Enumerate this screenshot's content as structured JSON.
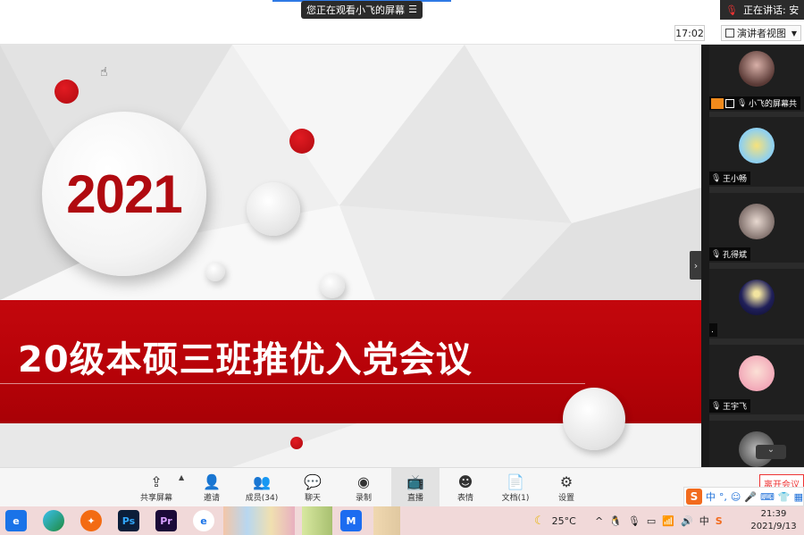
{
  "top_banner": {
    "viewing_text": "您正在观看小飞的屏幕",
    "speaking_text": "正在讲话: 安"
  },
  "header": {
    "time": "17:02",
    "presenter_view_label": "演讲者视图"
  },
  "slide": {
    "year": "2021",
    "title": "20级本硕三班推优入党会议"
  },
  "participants": [
    {
      "name": "小飞的屏幕共"
    },
    {
      "name": "王小畅"
    },
    {
      "name": "孔得斌"
    },
    {
      "name": "."
    },
    {
      "name": "王宇飞"
    }
  ],
  "toolbar": {
    "share_screen": "共享屏幕",
    "invite": "邀请",
    "members": "成员(34)",
    "chat": "聊天",
    "record": "录制",
    "live": "直播",
    "reactions": "表情",
    "documents": "文档(1)",
    "settings": "设置",
    "leave": "离开会议"
  },
  "ime": {
    "lang": "中"
  },
  "taskbar": {
    "weather": "25°C",
    "tray_lang": "中",
    "time": "21:39",
    "date": "2021/9/13",
    "apps": [
      "edge-legacy",
      "edge",
      "firefox-like",
      "Ps",
      "Pr",
      "ie",
      "tencent-meeting"
    ]
  }
}
